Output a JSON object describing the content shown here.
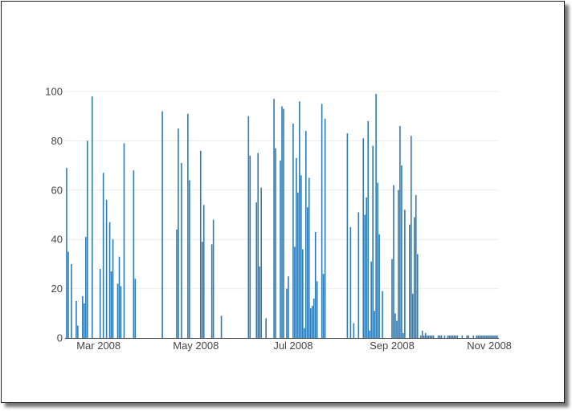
{
  "chart_data": {
    "type": "bar",
    "title": "",
    "xlabel": "",
    "ylabel": "",
    "ylim": [
      0,
      100
    ],
    "yticks": [
      0,
      20,
      40,
      60,
      80,
      100
    ],
    "xlim": [
      "2008-02-09",
      "2008-11-07"
    ],
    "xticks": [
      {
        "date": "2008-03-01",
        "label": "Mar 2008"
      },
      {
        "date": "2008-05-01",
        "label": "May 2008"
      },
      {
        "date": "2008-07-01",
        "label": "Jul 2008"
      },
      {
        "date": "2008-09-01",
        "label": "Sep 2008"
      },
      {
        "date": "2008-11-01",
        "label": "Nov 2008"
      }
    ],
    "grid": true,
    "colors": {
      "bar": "#2e7bb4",
      "grid": "#ececec",
      "axis": "#444444",
      "tick_text": "#444444"
    },
    "x": [
      "2008-02-10",
      "2008-02-11",
      "2008-02-13",
      "2008-02-16",
      "2008-02-17",
      "2008-02-20",
      "2008-02-21",
      "2008-02-22",
      "2008-02-23",
      "2008-02-26",
      "2008-03-02",
      "2008-03-04",
      "2008-03-06",
      "2008-03-08",
      "2008-03-09",
      "2008-03-10",
      "2008-03-13",
      "2008-03-14",
      "2008-03-15",
      "2008-03-17",
      "2008-03-23",
      "2008-03-24",
      "2008-04-10",
      "2008-04-19",
      "2008-04-20",
      "2008-04-22",
      "2008-04-26",
      "2008-04-27",
      "2008-05-04",
      "2008-05-05",
      "2008-05-06",
      "2008-05-11",
      "2008-05-12",
      "2008-05-17",
      "2008-06-03",
      "2008-06-04",
      "2008-06-08",
      "2008-06-09",
      "2008-06-10",
      "2008-06-11",
      "2008-06-14",
      "2008-06-19",
      "2008-06-20",
      "2008-06-23",
      "2008-06-24",
      "2008-06-25",
      "2008-06-27",
      "2008-06-28",
      "2008-07-01",
      "2008-07-02",
      "2008-07-03",
      "2008-07-04",
      "2008-07-05",
      "2008-07-06",
      "2008-07-07",
      "2008-07-08",
      "2008-07-09",
      "2008-07-10",
      "2008-07-11",
      "2008-07-12",
      "2008-07-13",
      "2008-07-14",
      "2008-07-15",
      "2008-07-16",
      "2008-07-19",
      "2008-07-20",
      "2008-07-21",
      "2008-08-04",
      "2008-08-06",
      "2008-08-08",
      "2008-08-11",
      "2008-08-14",
      "2008-08-15",
      "2008-08-16",
      "2008-08-17",
      "2008-08-18",
      "2008-08-19",
      "2008-08-20",
      "2008-08-21",
      "2008-08-22",
      "2008-08-23",
      "2008-08-24",
      "2008-08-26",
      "2008-09-01",
      "2008-09-02",
      "2008-09-03",
      "2008-09-04",
      "2008-09-05",
      "2008-09-06",
      "2008-09-07",
      "2008-09-08",
      "2008-09-09",
      "2008-09-12",
      "2008-09-13",
      "2008-09-14",
      "2008-09-15",
      "2008-09-16",
      "2008-09-17",
      "2008-09-19",
      "2008-09-20",
      "2008-09-21",
      "2008-09-22",
      "2008-09-23",
      "2008-09-24",
      "2008-09-25",
      "2008-09-26",
      "2008-09-27",
      "2008-09-30",
      "2008-10-01",
      "2008-10-02",
      "2008-10-04",
      "2008-10-06",
      "2008-10-07",
      "2008-10-08",
      "2008-10-09",
      "2008-10-10",
      "2008-10-11",
      "2008-10-12",
      "2008-10-15",
      "2008-10-18",
      "2008-10-19",
      "2008-10-22",
      "2008-10-24",
      "2008-10-25",
      "2008-10-26",
      "2008-10-27",
      "2008-10-28",
      "2008-10-29",
      "2008-10-30",
      "2008-10-31",
      "2008-11-01",
      "2008-11-02",
      "2008-11-03",
      "2008-11-04",
      "2008-11-05",
      "2008-11-06"
    ],
    "values": [
      69,
      35,
      30,
      15,
      5,
      17,
      14,
      41,
      80,
      98,
      28,
      67,
      56,
      47,
      27,
      40,
      22,
      33,
      21,
      79,
      68,
      24,
      92,
      44,
      85,
      71,
      91,
      64,
      76,
      39,
      54,
      38,
      48,
      9,
      90,
      74,
      55,
      75,
      29,
      61,
      8,
      97,
      77,
      72,
      94,
      93,
      20,
      25,
      87,
      37,
      73,
      59,
      96,
      66,
      36,
      4,
      84,
      53,
      65,
      12,
      13,
      16,
      43,
      23,
      95,
      26,
      89,
      83,
      45,
      6,
      51,
      81,
      50,
      57,
      88,
      3,
      31,
      78,
      11,
      99,
      63,
      42,
      19,
      32,
      62,
      10,
      7,
      60,
      86,
      70,
      2,
      52,
      46,
      82,
      18,
      49,
      58,
      34,
      1,
      3,
      1,
      2,
      1,
      1,
      1,
      1,
      1,
      1,
      1,
      1,
      1,
      1,
      1,
      1,
      1,
      1,
      1,
      1,
      1,
      1,
      1,
      1,
      1,
      1,
      1,
      1,
      1,
      1,
      1,
      1,
      1,
      1,
      1,
      1,
      1,
      1
    ]
  }
}
